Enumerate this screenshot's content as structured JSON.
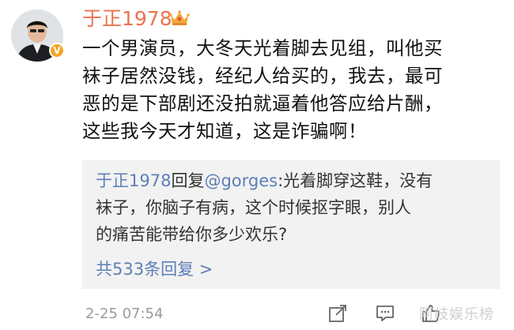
{
  "post": {
    "username": "于正1978",
    "crown_icon": "crown-icon",
    "verified_icon": "verified-v-badge",
    "content_lines": [
      "一个男演员，大冬天光着脚去见组，叫他买",
      "袜子居然没钱，经纪人给买的，我去，最可",
      "恶的是下部剧还没拍就逼着他答应给片酬，",
      "这些我今天才知道，这是诈骗啊！"
    ],
    "timestamp": "2-25 07:54"
  },
  "reply": {
    "author": "于正1978",
    "verb": "回复",
    "mention": "@gorges",
    "first_line_rest": ":光着脚穿这鞋，没有",
    "lines": [
      "袜子，你脑子有病，这个时候抠字眼，别人",
      "的痛苦能带给你多少欢乐?"
    ],
    "count_label": "共533条回复 >"
  },
  "actions": {
    "share_icon": "share-icon",
    "comment_icon": "comment-icon",
    "like_icon": "like-icon"
  },
  "watermark": "阿岐娱乐榜",
  "colors": {
    "username": "#eb7350",
    "link": "#5d7fb8",
    "reply_bg": "#f2f2f2",
    "meta_gray": "#9a9a9a",
    "badge": "#f5a623"
  }
}
